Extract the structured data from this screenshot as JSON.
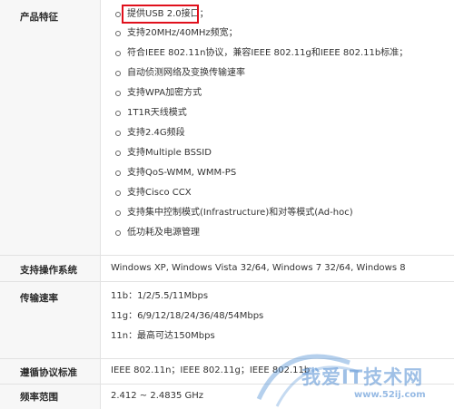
{
  "features": {
    "label": "产品特征",
    "items": [
      "提供USB 2.0接口；",
      "支持20MHz/40MHz频宽；",
      "符合IEEE 802.11n协议，兼容IEEE 802.11g和IEEE 802.11b标准；",
      "自动侦测网络及变换传输速率",
      "支持WPA加密方式",
      "1T1R天线模式",
      "支持2.4G频段",
      "支持Multiple BSSID",
      "支持QoS-WMM, WMM-PS",
      "支持Cisco CCX",
      "支持集中控制模式(Infrastructure)和对等模式(Ad-hoc)",
      "低功耗及电源管理"
    ]
  },
  "os": {
    "label": "支持操作系统",
    "value": "Windows XP, Windows Vista 32/64, Windows 7 32/64, Windows 8"
  },
  "rate": {
    "label": "传输速率",
    "lines": [
      "11b：1/2/5.5/11Mbps",
      "11g：6/9/12/18/24/36/48/54Mbps",
      "11n：最高可达150Mbps"
    ]
  },
  "protocol": {
    "label": "遵循协议标准",
    "value": "IEEE 802.11n；IEEE 802.11g；IEEE 802.11b"
  },
  "freq": {
    "label": "频率范围",
    "value": "2.412 ~ 2.4835 GHz"
  },
  "watermark": {
    "text": "我爱IT技术网",
    "url": "www.52ij.com"
  },
  "colors": {
    "highlight_border": "#e0101c",
    "label_background": "#f7f7f7",
    "watermark": "#508cd2"
  }
}
